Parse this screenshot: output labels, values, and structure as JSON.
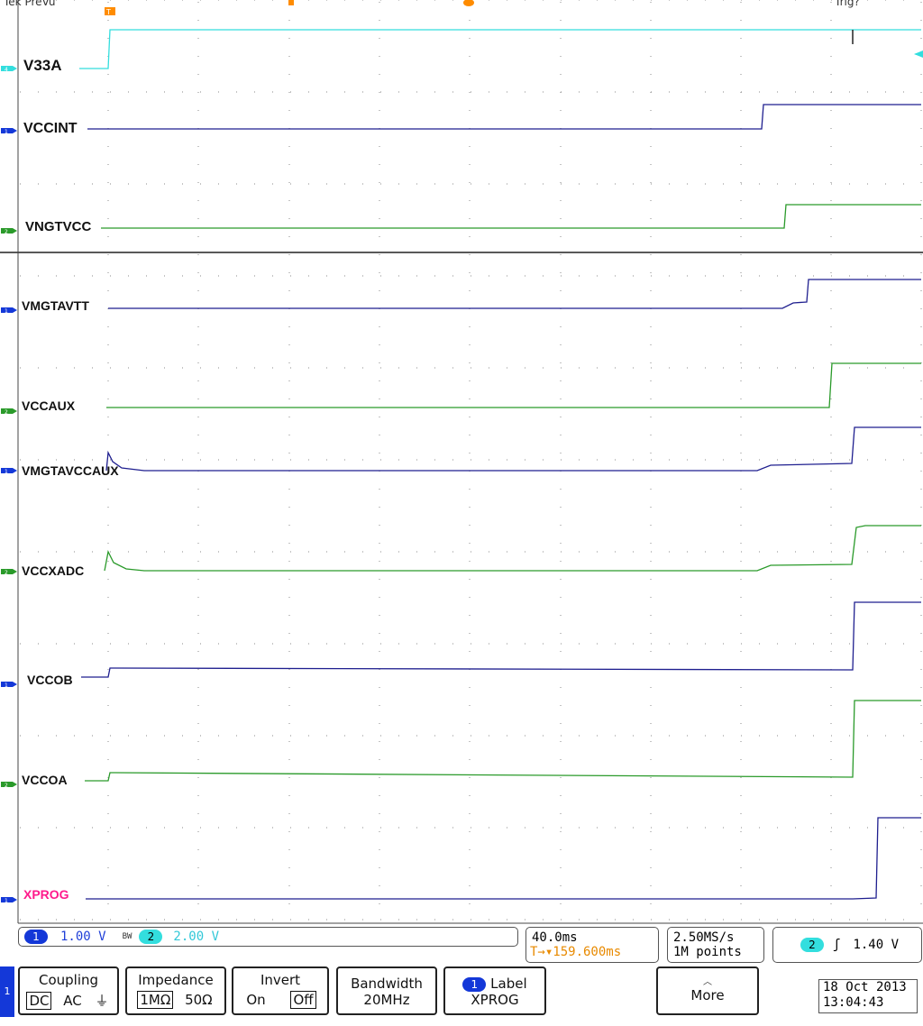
{
  "header": {
    "left_label": "Tek PreVu",
    "right_label": "Trig?"
  },
  "colors": {
    "ch1": "#1f1f8f",
    "ch2": "#2a9a2a",
    "cyan": "#33dede",
    "xprog_label": "#ff1a8c",
    "orange": "#ff8c00"
  },
  "channels": [
    {
      "label": "V33A",
      "marker": "4"
    },
    {
      "label": "VCCINT",
      "marker": "1"
    },
    {
      "label": "VNGTVCC",
      "marker": "2"
    },
    {
      "label": "VMGTAVTT",
      "marker": "1"
    },
    {
      "label": "VCCAUX",
      "marker": "2"
    },
    {
      "label": "VMGTAVCCAUX",
      "marker": "1"
    },
    {
      "label": "VCCXADC",
      "marker": "2"
    },
    {
      "label": "VCCOB",
      "marker": "1"
    },
    {
      "label": "VCCOA",
      "marker": "2"
    },
    {
      "label": "XPROG",
      "marker": "1"
    }
  ],
  "status": {
    "ch1_num": "1",
    "ch1_scale": "1.00 V",
    "bw_symbol": "BW",
    "ch2_num": "2",
    "ch2_scale": "2.00 V",
    "timebase": "40.0ms",
    "trigger_position": "T→▾159.600ms",
    "sample_rate": "2.50MS/s",
    "record_length": "1M points",
    "trig_source": "2",
    "trig_slope": "ʃ",
    "trig_level": "1.40 V"
  },
  "side_tab": "1",
  "menu": {
    "coupling_title": "Coupling",
    "coupling_dc": "DC",
    "coupling_ac": "AC",
    "coupling_gnd": "⏚",
    "impedance_title": "Impedance",
    "impedance_1m": "1MΩ",
    "impedance_50": "50Ω",
    "invert_title": "Invert",
    "invert_on": "On",
    "invert_off": "Off",
    "bandwidth_title": "Bandwidth",
    "bandwidth_value": "20MHz",
    "label_num": "1",
    "label_title": "Label",
    "label_value": "XPROG",
    "more_label": "More"
  },
  "datetime": {
    "date": "18 Oct  2013",
    "time": "13:04:43"
  }
}
